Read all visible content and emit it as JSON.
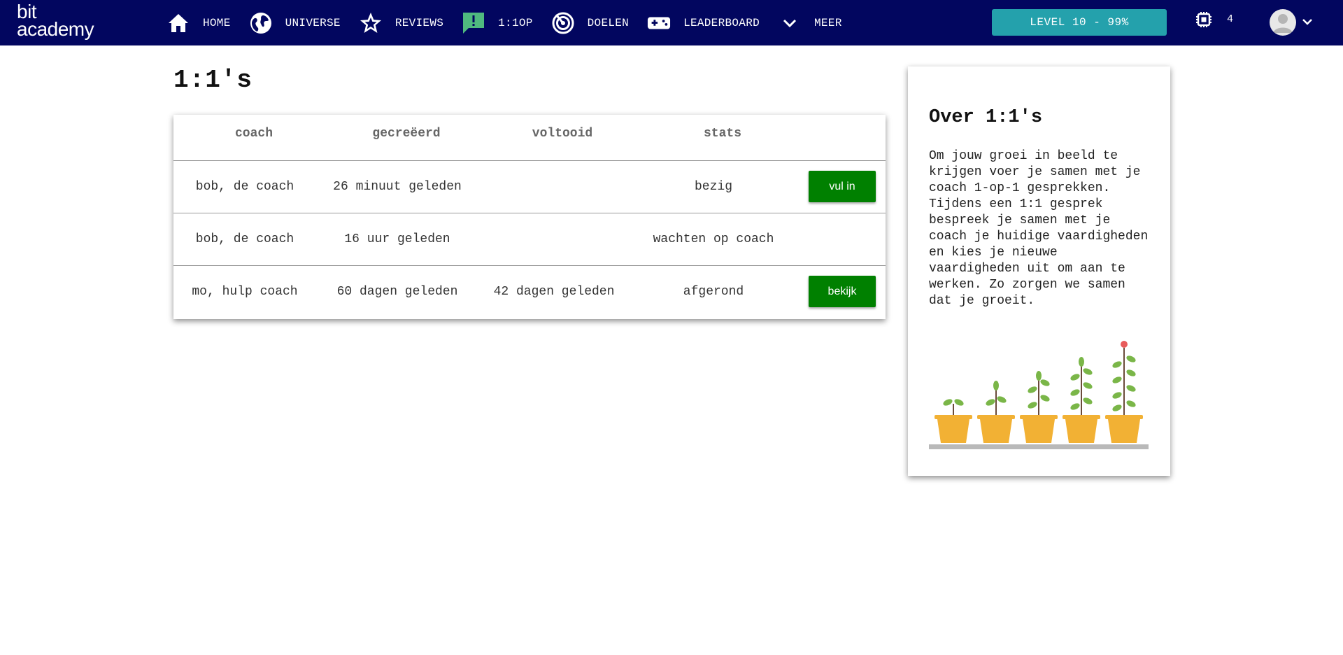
{
  "brand": {
    "line1": "bit",
    "line2": "academy"
  },
  "nav": [
    {
      "label": "HOME",
      "icon": "home-icon"
    },
    {
      "label": "UNIVERSE",
      "icon": "globe-icon"
    },
    {
      "label": "REVIEWS",
      "icon": "star-icon"
    },
    {
      "label": "1:1OP",
      "icon": "alert-chat-icon"
    },
    {
      "label": "DOELEN",
      "icon": "target-icon"
    },
    {
      "label": "LEADERBOARD",
      "icon": "gamepad-icon"
    },
    {
      "label": "MEER",
      "icon": "chevron-down-icon"
    }
  ],
  "level": {
    "label": "LEVEL 10 - 99%"
  },
  "chip": {
    "count": "4",
    "icon": "chip-icon"
  },
  "page": {
    "title": "1:1's"
  },
  "table": {
    "headers": [
      "coach",
      "gecreëerd",
      "voltooid",
      "stats"
    ],
    "rows": [
      {
        "coach": "bob, de coach",
        "created": "26 minuut geleden",
        "completed": "",
        "status": "bezig",
        "action": "vul in"
      },
      {
        "coach": "bob, de coach",
        "created": "16 uur geleden",
        "completed": "",
        "status": "wachten op coach",
        "action": ""
      },
      {
        "coach": "mo, hulp coach",
        "created": "60 dagen geleden",
        "completed": "42 dagen geleden",
        "status": "afgerond",
        "action": "bekijk"
      }
    ]
  },
  "about": {
    "title": "Over 1:1's",
    "text": "Om jouw groei in beeld te krijgen voer je samen met je coach 1-op-1 gesprekken. Tijdens een 1:1 gesprek bespreek je samen met je coach je huidige vaardigheden en kies je nieuwe vaardigheden uit om aan te werken. Zo zorgen we samen dat je groeit."
  },
  "colors": {
    "navbar": "#02065f",
    "accent": "#24a1ac",
    "button": "#008000",
    "pot": "#f2b134",
    "leaf": "#7ab648"
  }
}
